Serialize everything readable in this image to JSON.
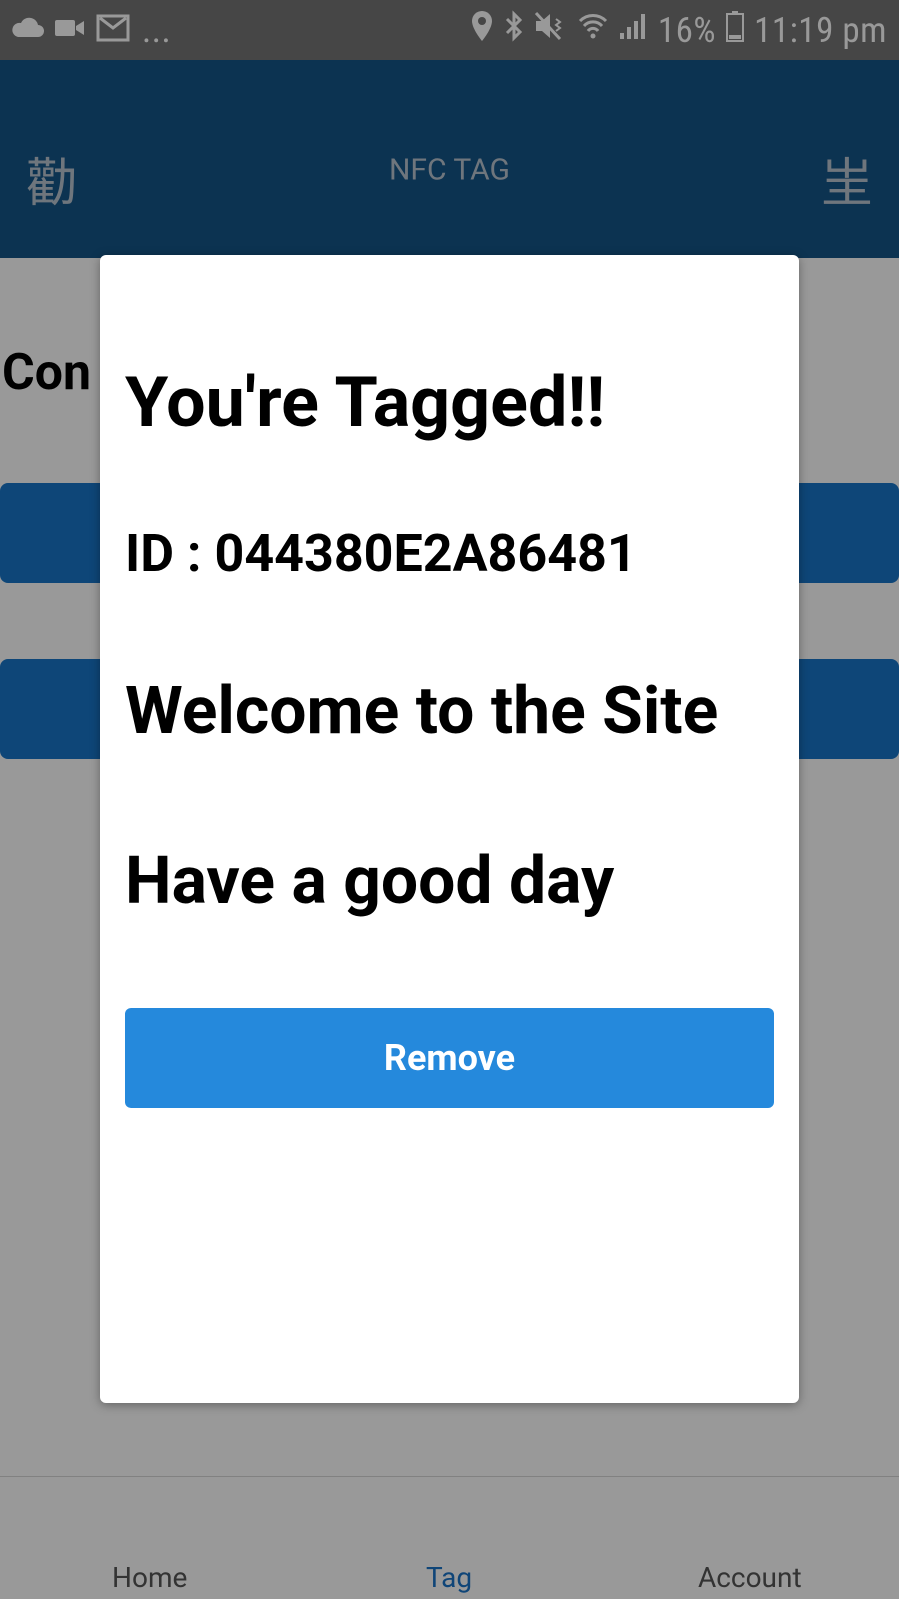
{
  "status_bar": {
    "battery_percent": "16%",
    "time": "11:19 pm",
    "more_notifications": "...",
    "icons_left": [
      "cloud-icon",
      "video-camera-icon",
      "gmail-icon"
    ],
    "icons_right": [
      "location-icon",
      "bluetooth-icon",
      "mute-icon",
      "wifi-icon",
      "signal-icon",
      "battery-icon"
    ]
  },
  "header": {
    "title": "NFC TAG",
    "left_icon_glyph": "勸",
    "right_icon_glyph": "㞷"
  },
  "background": {
    "label_partial": "Con"
  },
  "modal": {
    "title": "You're Tagged!!",
    "id_text": "ID : 044380E2A86481",
    "welcome": "Welcome to the Site",
    "farewell": "Have a good day",
    "remove_label": "Remove"
  },
  "bottom_nav": {
    "items": [
      {
        "label": "Home",
        "active": false
      },
      {
        "label": "Tag",
        "active": true
      },
      {
        "label": "Account",
        "active": false
      }
    ]
  },
  "colors": {
    "header_bg": "#155587",
    "primary_button": "#2589dc",
    "active_nav": "#1a73c9"
  }
}
